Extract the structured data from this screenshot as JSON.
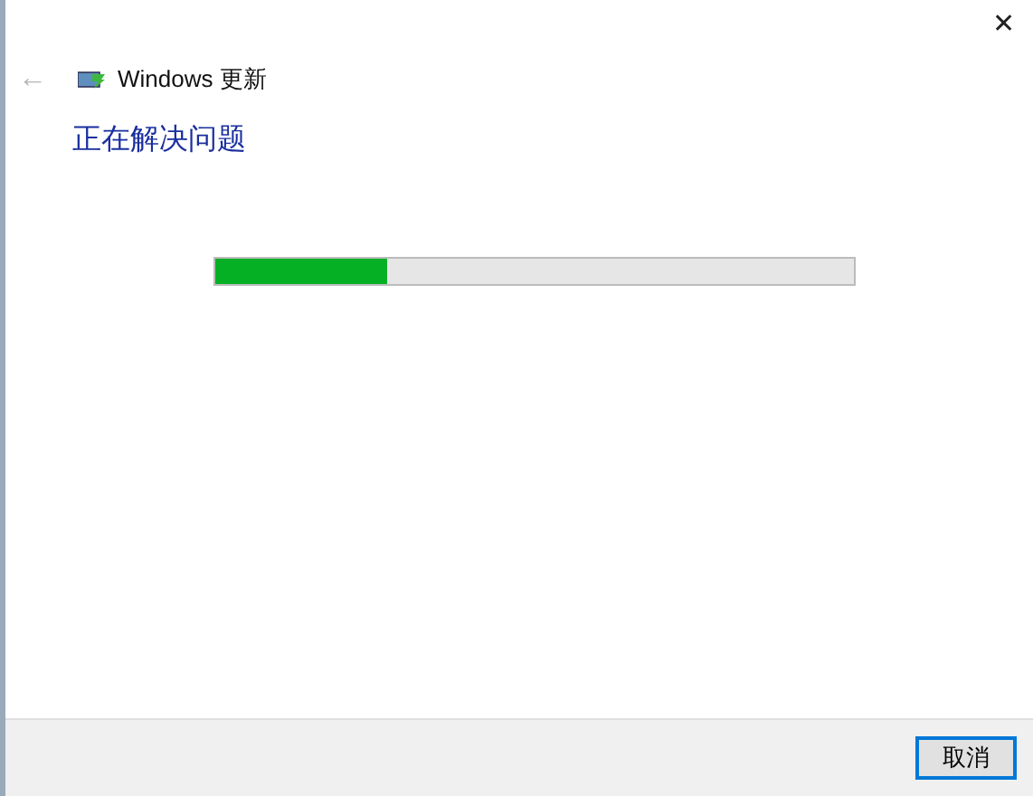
{
  "window": {
    "close": "✕"
  },
  "header": {
    "back": "←",
    "title": "Windows 更新",
    "back_disabled": true
  },
  "heading": "正在解决问题",
  "progress": {
    "level": 0.27
  },
  "footer": {
    "buttons": [
      {
        "label": "取消",
        "focused": true
      }
    ]
  }
}
